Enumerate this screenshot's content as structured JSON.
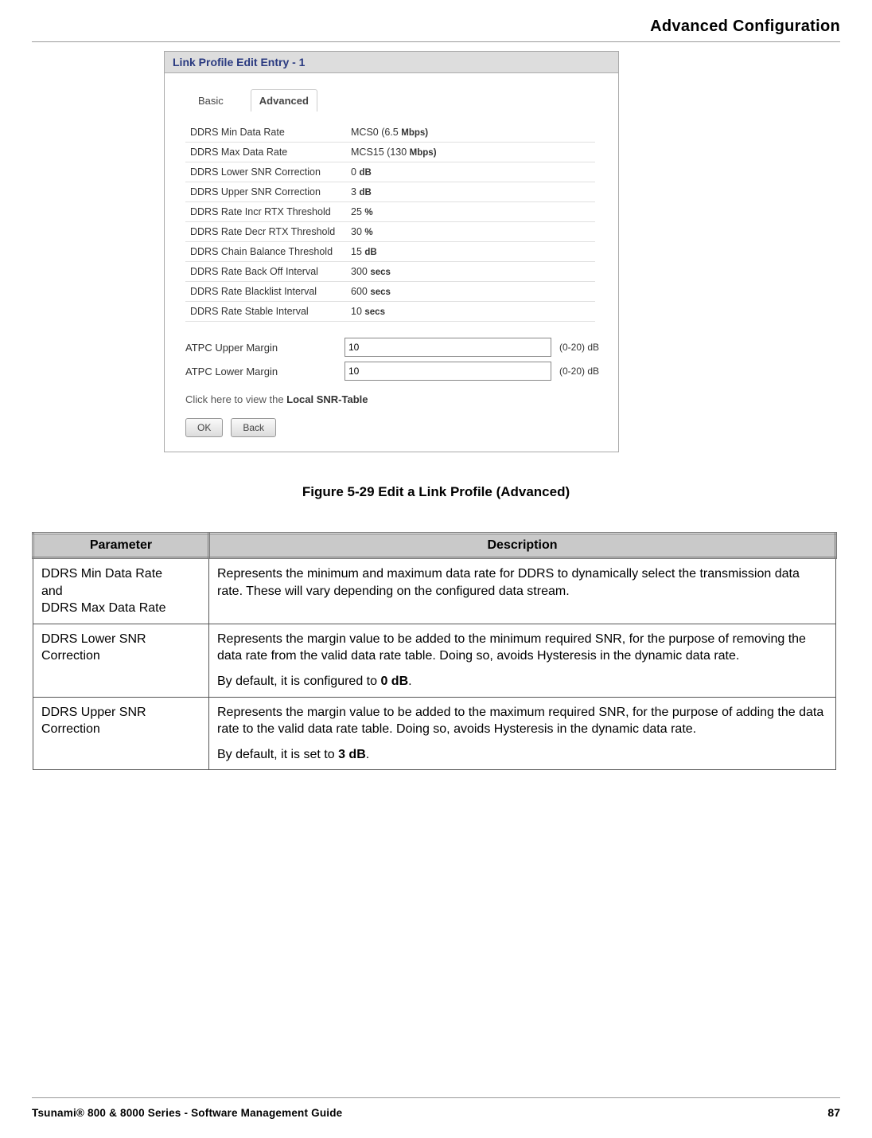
{
  "header": {
    "title": "Advanced Configuration"
  },
  "window": {
    "title": "Link Profile Edit Entry - 1",
    "tabs": {
      "basic": "Basic",
      "advanced": "Advanced"
    },
    "rows": [
      {
        "label": "DDRS Min Data Rate",
        "value": "MCS0  (6.5",
        "unit": "Mbps)"
      },
      {
        "label": "DDRS Max Data Rate",
        "value": "MCS15  (130",
        "unit": "Mbps)"
      },
      {
        "label": "DDRS Lower SNR Correction",
        "value": "0",
        "unit": "dB"
      },
      {
        "label": "DDRS Upper SNR Correction",
        "value": "3",
        "unit": "dB"
      },
      {
        "label": "DDRS Rate Incr RTX Threshold",
        "value": "25",
        "unit": "%"
      },
      {
        "label": "DDRS Rate Decr RTX Threshold",
        "value": "30",
        "unit": "%"
      },
      {
        "label": "DDRS Chain Balance Threshold",
        "value": "15",
        "unit": "dB"
      },
      {
        "label": "DDRS Rate Back Off Interval",
        "value": "300",
        "unit": "secs"
      },
      {
        "label": "DDRS Rate Blacklist Interval",
        "value": "600",
        "unit": "secs"
      },
      {
        "label": "DDRS Rate Stable Interval",
        "value": "10",
        "unit": "secs"
      }
    ],
    "atpc": {
      "upper": {
        "label": "ATPC Upper Margin",
        "value": "10",
        "range": "(0-20) dB"
      },
      "lower": {
        "label": "ATPC Lower Margin",
        "value": "10",
        "range": "(0-20) dB"
      }
    },
    "snrline": {
      "prefix": "Click here to view the ",
      "link": "Local SNR-Table"
    },
    "buttons": {
      "ok": "OK",
      "back": "Back"
    }
  },
  "figure_caption": "Figure 5-29 Edit a Link Profile (Advanced)",
  "desc_table": {
    "headers": {
      "param": "Parameter",
      "desc": "Description"
    },
    "rows": [
      {
        "param_l1": "DDRS Min Data Rate",
        "param_l2": "and",
        "param_l3": "DDRS Max Data Rate",
        "desc_p1": "Represents the minimum and maximum data rate for DDRS to dynamically select the transmission data rate. These will vary depending on the configured data stream."
      },
      {
        "param_l1": "DDRS Lower SNR Correction",
        "desc_p1": "Represents the margin value to be added to the minimum required SNR, for the purpose of removing the data rate from the valid data rate table. Doing so, avoids Hysteresis in the dynamic data rate.",
        "desc_p2a": "By default, it is configured to ",
        "desc_p2b": "0 dB",
        "desc_p2c": "."
      },
      {
        "param_l1": "DDRS Upper SNR Correction",
        "desc_p1": "Represents the margin value to be added to the maximum required SNR, for the purpose of adding the data rate to the valid data rate table. Doing so, avoids Hysteresis in the dynamic data rate.",
        "desc_p2a": "By default, it is set to ",
        "desc_p2b": "3 dB",
        "desc_p2c": "."
      }
    ]
  },
  "footer": {
    "left": "Tsunami® 800 & 8000 Series - Software Management Guide",
    "right": "87"
  }
}
